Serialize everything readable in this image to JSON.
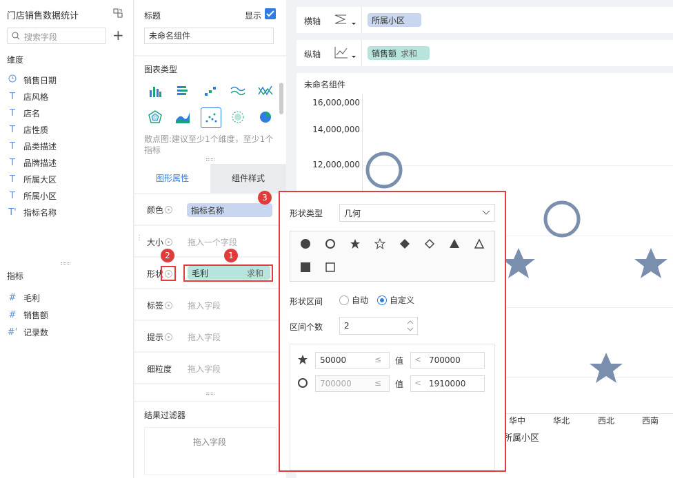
{
  "left": {
    "title": "门店销售数据统计",
    "search_placeholder": "搜索字段",
    "dim_title": "维度",
    "dimensions": [
      {
        "type": "clock",
        "label": "销售日期"
      },
      {
        "type": "T",
        "label": "店风格"
      },
      {
        "type": "T",
        "label": "店名"
      },
      {
        "type": "T",
        "label": "店性质"
      },
      {
        "type": "T",
        "label": "品类描述"
      },
      {
        "type": "T",
        "label": "品牌描述"
      },
      {
        "type": "T",
        "label": "所属大区"
      },
      {
        "type": "T",
        "label": "所属小区"
      },
      {
        "type": "T'",
        "label": "指标名称"
      }
    ],
    "measure_title": "指标",
    "measures": [
      {
        "type": "#",
        "label": "毛利"
      },
      {
        "type": "#",
        "label": "销售额"
      },
      {
        "type": "#'",
        "label": "记录数"
      }
    ]
  },
  "mid": {
    "title_label": "标题",
    "show_label": "显示",
    "title_value": "未命名组件",
    "chart_type_label": "图表类型",
    "chart_hint": "散点图:建议至少1个维度，至少1个指标",
    "tab_graph": "图形属性",
    "tab_style": "组件样式",
    "color_label": "颜色",
    "color_pill": "指标名称",
    "size_label": "大小",
    "size_drop": "拖入一个字段",
    "shape_label": "形状",
    "shape_pill_name": "毛利",
    "shape_pill_agg": "求和",
    "label_label": "标签",
    "label_drop": "拖入字段",
    "tip_label": "提示",
    "tip_drop": "拖入字段",
    "grain_label": "细粒度",
    "grain_drop": "拖入字段",
    "filter_title": "结果过滤器",
    "filter_drop": "拖入字段"
  },
  "axes": {
    "x_label": "横轴",
    "x_pill": "所属小区",
    "y_label": "纵轴",
    "y_pill_name": "销售额",
    "y_pill_agg": "求和"
  },
  "chart": {
    "title": "未命名组件",
    "xaxis_title": "所属小区"
  },
  "chart_data": {
    "type": "scatter",
    "title": "未命名组件",
    "xlabel": "所属小区",
    "ylabel": "",
    "y_ticks": [
      "16,000,000",
      "14,000,000",
      "12,000,000"
    ],
    "categories_visible": [
      "华中",
      "华北",
      "西北",
      "西南"
    ],
    "points": [
      {
        "shape": "circle",
        "y": 12200000
      },
      {
        "shape": "circle",
        "y": 10800000
      },
      {
        "shape": "star",
        "y": 8200000
      },
      {
        "shape": "star",
        "y": 8200000
      },
      {
        "shape": "star",
        "y": 2800000
      }
    ]
  },
  "popup": {
    "shape_type_label": "形状类型",
    "shape_type_value": "几何",
    "shapes": [
      "filled-circle",
      "circle",
      "filled-star",
      "star",
      "filled-diamond",
      "diamond",
      "filled-triangle",
      "triangle",
      "filled-square",
      "square"
    ],
    "interval_label": "形状区间",
    "opt_auto": "自动",
    "opt_custom": "自定义",
    "count_label": "区间个数",
    "count_value": "2",
    "rows": [
      {
        "icon": "filled-star",
        "from": "50000",
        "op1": "≤",
        "mid": "值",
        "op2": "<",
        "to": "700000"
      },
      {
        "icon": "circle",
        "from": "700000",
        "op1": "≤",
        "mid": "值",
        "op2": "<",
        "to": "1910000"
      }
    ]
  },
  "badges": [
    "1",
    "2",
    "3"
  ],
  "colors": {
    "accent": "#2f7de1",
    "highlight": "#e03c3c",
    "pill_blue": "#c9d6f0",
    "pill_green": "#b7e4dc",
    "marker": "#7a8fad"
  }
}
